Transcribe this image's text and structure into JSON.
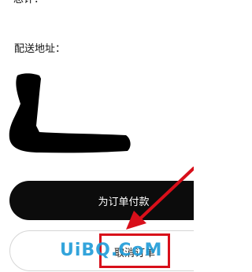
{
  "order": {
    "total_label": "总计：",
    "address_label": "配送地址："
  },
  "actions": {
    "pay_label": "为订单付款",
    "cancel_label": "取消订单"
  },
  "annotation": {
    "highlight_color": "#d80f1a",
    "arrow_color": "#d80f1a"
  },
  "watermark": {
    "text": "UiBQ.CoM",
    "color": "#1d9bd8"
  }
}
